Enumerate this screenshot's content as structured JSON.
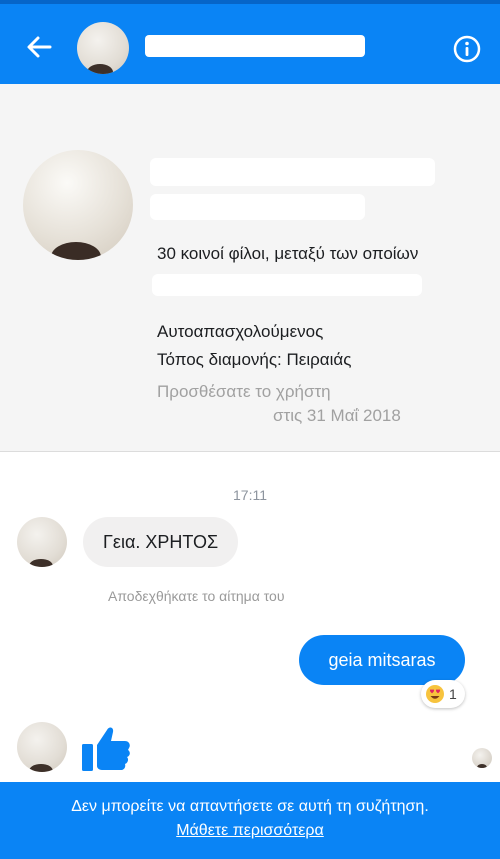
{
  "header": {
    "contact_name": "",
    "back_icon": "back-arrow-icon",
    "info_icon": "info-icon",
    "colors": {
      "bar": "#0a84f5"
    }
  },
  "profile": {
    "name_line_1": "",
    "name_line_2": "",
    "mutual_friends": "30 κοινοί φίλοι, μεταξύ των οποίων",
    "occupation": "Αυτοαπασχολούμενος",
    "residence": "Τόπος διαμονής: Πειραιάς",
    "added_line_1": "Προσθέσατε το χρήστη",
    "added_line_2": "στις 31 Μαΐ 2018"
  },
  "conversation": {
    "timestamp": "17:11",
    "incoming_message": "Γεια.  ΧΡΗΤΟΣ",
    "system_message": "Αποδεχθήκατε το αίτημα του",
    "outgoing_message": "geia mitsaras",
    "reaction": {
      "icon": "heart-eyes-emoji-icon",
      "count": "1"
    },
    "sticker_icon": "thumbs-up-icon"
  },
  "footer": {
    "notice": "Δεν μπορείτε να απαντήσετε σε αυτή τη συζήτηση.",
    "learn_more": "Μάθετε περισσότερα"
  }
}
